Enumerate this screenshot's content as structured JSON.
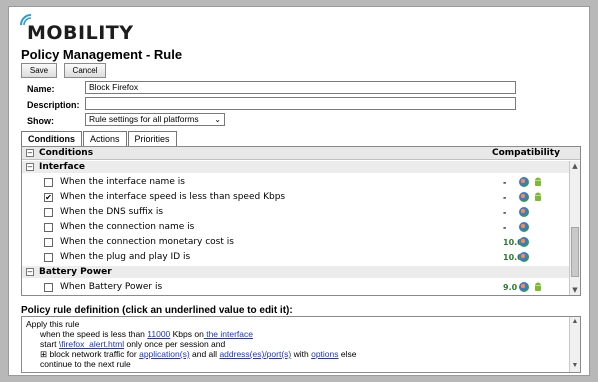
{
  "app": {
    "logo_text": "MOBILITY",
    "page_title": "Policy Management - Rule"
  },
  "toolbar": {
    "save_label": "Save",
    "cancel_label": "Cancel"
  },
  "form": {
    "name_label": "Name:",
    "name_value": "Block Firefox",
    "description_label": "Description:",
    "description_value": "",
    "show_label": "Show:",
    "show_value": "Rule settings for all platforms"
  },
  "tabs": [
    {
      "label": "Conditions",
      "active": true
    },
    {
      "label": "Actions",
      "active": false
    },
    {
      "label": "Priorities",
      "active": false
    }
  ],
  "conditions": {
    "header_toggle": "−",
    "header_label": "Conditions",
    "compat_header": "Compatibility",
    "groups": [
      {
        "label": "Interface",
        "toggle": "−",
        "rows": [
          {
            "label": "When the interface name is",
            "checked": false,
            "compat": "-",
            "icons": [
              "windows-icon",
              "android-icon"
            ]
          },
          {
            "label": "When the interface speed is less than speed Kbps",
            "checked": true,
            "compat": "-",
            "icons": [
              "windows-icon",
              "android-icon"
            ]
          },
          {
            "label": "When the DNS suffix is",
            "checked": false,
            "compat": "-",
            "icons": [
              "windows-icon"
            ]
          },
          {
            "label": "When the connection name is",
            "checked": false,
            "compat": "-",
            "icons": [
              "windows-icon"
            ]
          },
          {
            "label": "When the connection monetary cost is",
            "checked": false,
            "compat": "10.0",
            "icons": [
              "windows-icon"
            ]
          },
          {
            "label": "When the plug and play ID is",
            "checked": false,
            "compat": "10.0",
            "icons": [
              "windows-icon"
            ]
          }
        ]
      },
      {
        "label": "Battery Power",
        "toggle": "−",
        "rows": [
          {
            "label": "When Battery Power is",
            "checked": false,
            "compat": "9.0",
            "icons": [
              "windows-icon",
              "android-icon"
            ]
          }
        ]
      }
    ],
    "check_mark": "✔"
  },
  "definition": {
    "title": "Policy rule definition (click an underlined value to edit it):",
    "l1": "Apply this rule",
    "l2_a": "when the speed is less than ",
    "l2_link1": "11000",
    "l2_b": " Kbps on",
    "l2_link2": " the interface",
    "l3_a": "start ",
    "l3_link": "\\firefox_alert.html",
    "l3_b": " only once per session and",
    "l4_toggle": "⊞",
    "l4_a": " block network traffic for ",
    "l4_link1": "application(s)",
    "l4_b": " and all ",
    "l4_link2": "address(es)/port(s)",
    "l4_c": " with ",
    "l4_link3": "options",
    "l4_d": " else",
    "l5": "continue to the next rule"
  },
  "colors": {
    "compat_green": "#2e7d2e",
    "link_blue": "#1a35c9"
  }
}
